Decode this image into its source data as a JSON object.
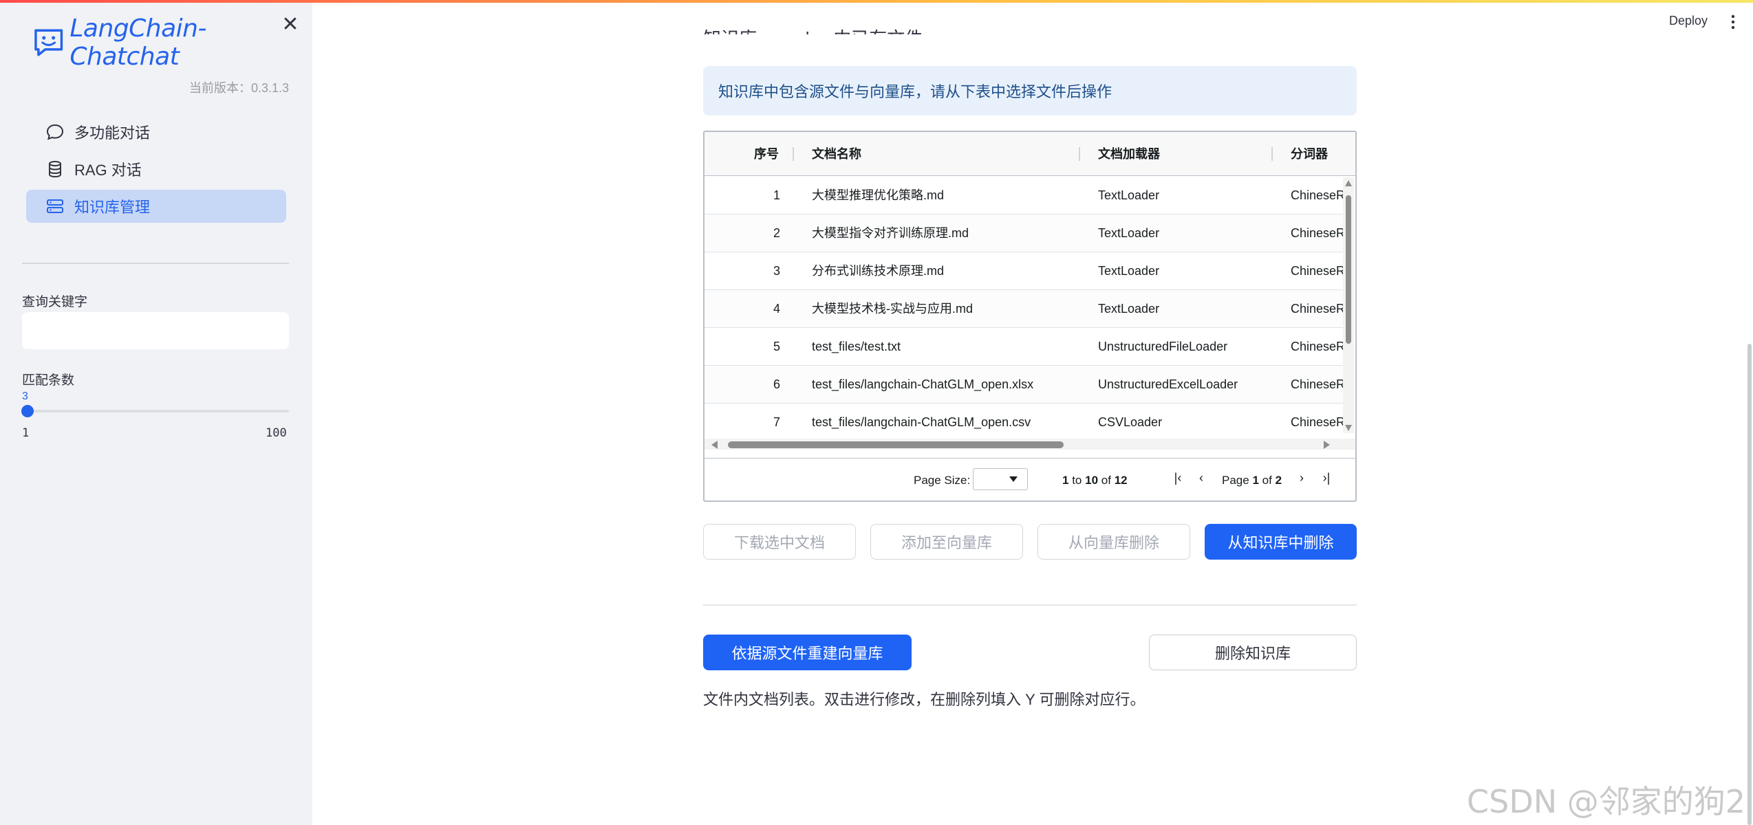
{
  "sidebar": {
    "logo_text": "LangChain-Chatchat",
    "close_symbol": "✕",
    "version": "当前版本：0.3.1.3",
    "nav": [
      {
        "label": "多功能对话",
        "icon": "chat-bubble-icon",
        "active": false
      },
      {
        "label": "RAG 对话",
        "icon": "database-icon",
        "active": false
      },
      {
        "label": "知识库管理",
        "icon": "server-stack-icon",
        "active": true
      }
    ],
    "keyword_label": "查询关键字",
    "keyword_value": "",
    "match_label": "匹配条数",
    "slider": {
      "value": "3",
      "min": "1",
      "max": "100"
    }
  },
  "header": {
    "deploy_label": "Deploy",
    "menu_icon": "kebab-menu-icon"
  },
  "main": {
    "partial_heading": "知识库 samples 中已有文件",
    "info_text": "知识库中包含源文件与向量库，请从下表中选择文件后操作",
    "grid": {
      "columns": [
        "序号",
        "文档名称",
        "文档加载器",
        "分词器"
      ],
      "rows": [
        {
          "idx": "1",
          "name": "大模型推理优化策略.md",
          "loader": "TextLoader",
          "splitter": "ChineseRecursiveTextSplitter"
        },
        {
          "idx": "2",
          "name": "大模型指令对齐训练原理.md",
          "loader": "TextLoader",
          "splitter": "ChineseRecursiveTextSplitter"
        },
        {
          "idx": "3",
          "name": "分布式训练技术原理.md",
          "loader": "TextLoader",
          "splitter": "ChineseRecursiveTextSplitter"
        },
        {
          "idx": "4",
          "name": "大模型技术栈-实战与应用.md",
          "loader": "TextLoader",
          "splitter": "ChineseRecursiveTextSplitter"
        },
        {
          "idx": "5",
          "name": "test_files/test.txt",
          "loader": "UnstructuredFileLoader",
          "splitter": "ChineseRecursiveTextSplitter"
        },
        {
          "idx": "6",
          "name": "test_files/langchain-ChatGLM_open.xlsx",
          "loader": "UnstructuredExcelLoader",
          "splitter": "ChineseRecursiveTextSplitter"
        },
        {
          "idx": "7",
          "name": "test_files/langchain-ChatGLM_open.csv",
          "loader": "CSVLoader",
          "splitter": "ChineseRecursiveTextSplitter"
        }
      ],
      "paging": {
        "page_size_label": "Page Size:",
        "from": "1",
        "to_word": "to",
        "to": "10",
        "of_word": "of",
        "total": "12",
        "page_word": "Page",
        "page": "1",
        "pages": "2"
      }
    },
    "buttons": {
      "download": "下载选中文档",
      "add_to_vector": "添加至向量库",
      "delete_from_vector": "从向量库删除",
      "delete_from_kb": "从知识库中删除",
      "rebuild": "依据源文件重建向量库",
      "delete_kb": "删除知识库"
    },
    "caption": "文件内文档列表。双击进行修改，在删除列填入 Y 可删除对应行。"
  },
  "watermark": "CSDN @邻家的狗2",
  "colors": {
    "accent": "#1f63f5",
    "sidebar_bg": "#f0f2f6",
    "info_bg": "#e8f1fb",
    "active_nav_bg": "#c7d7f6"
  }
}
